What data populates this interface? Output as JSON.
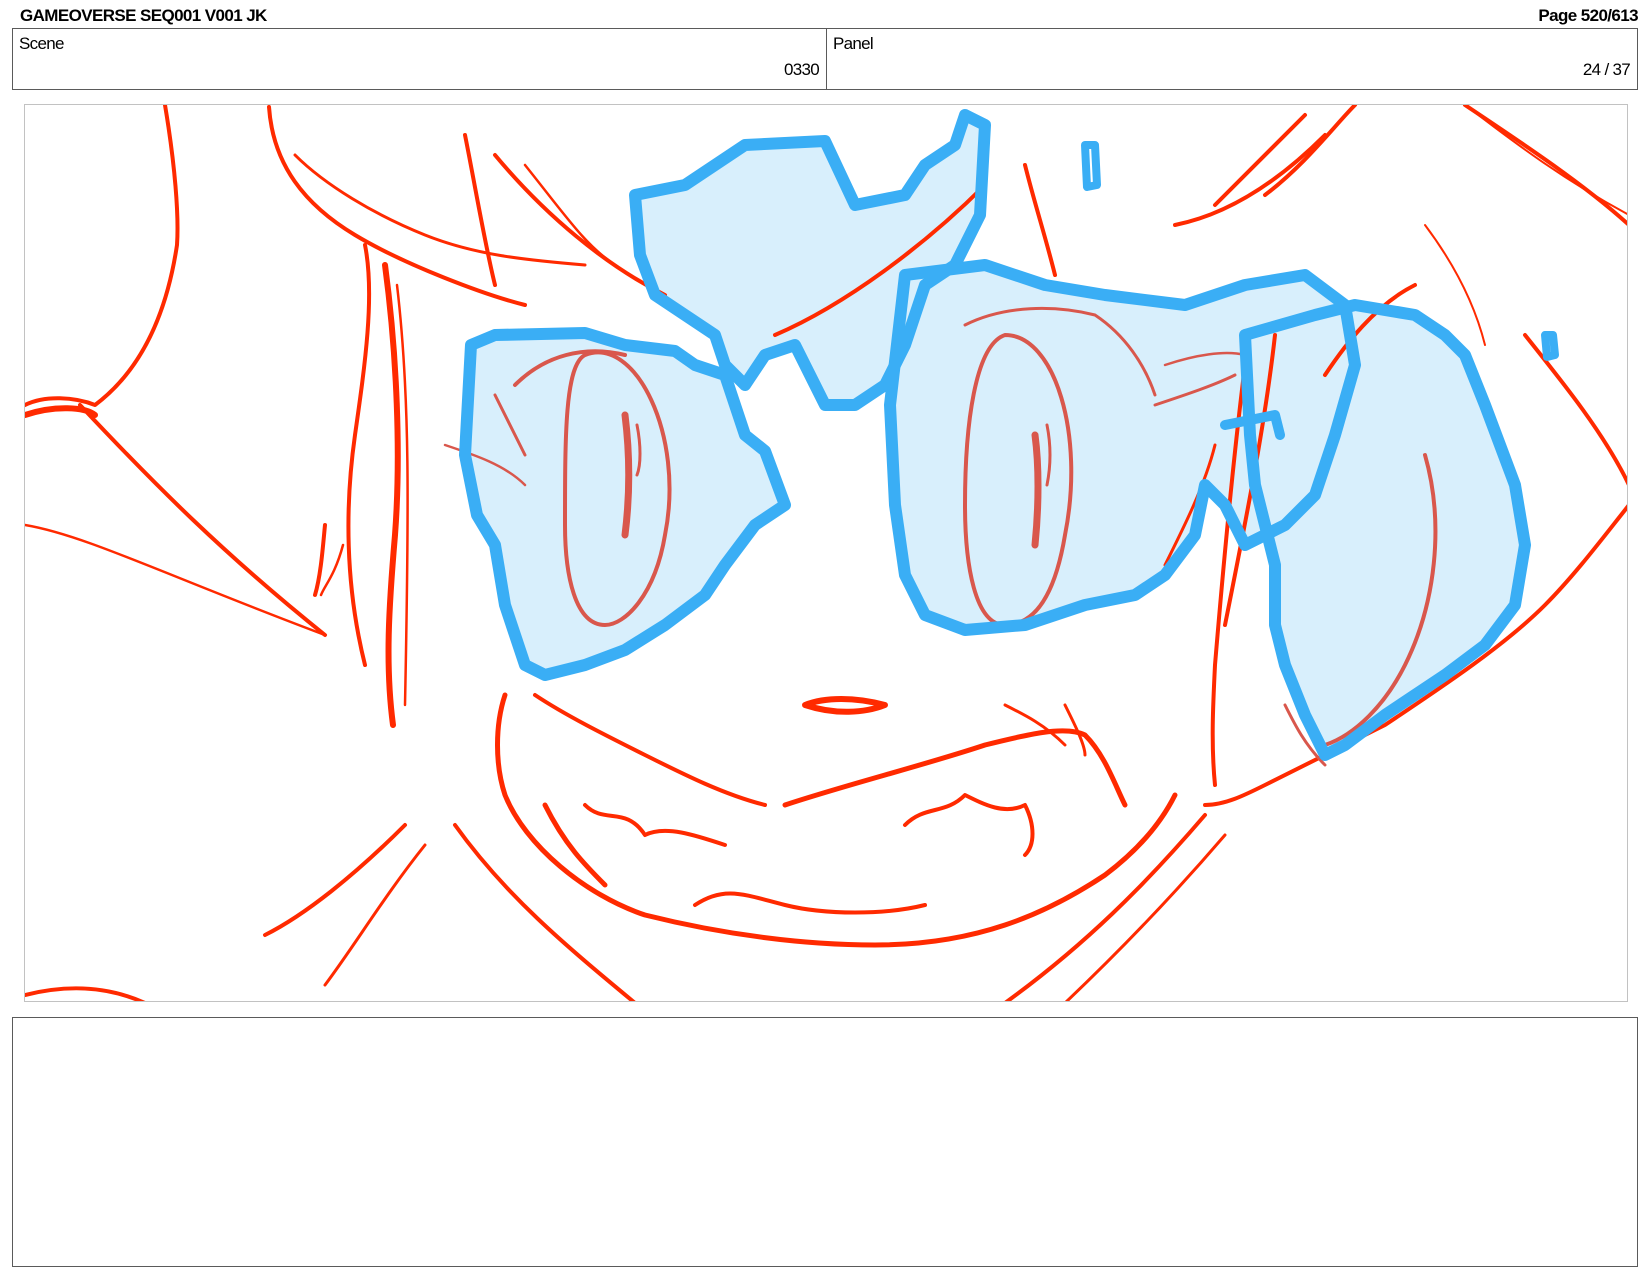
{
  "header": {
    "title": "GAMEOVERSE SEQ001 V001 JK",
    "page": "Page 520/613"
  },
  "scene": {
    "label": "Scene",
    "value": "0330"
  },
  "panel": {
    "label": "Panel",
    "value": "24 / 37"
  },
  "colors": {
    "sketch_red": "#ff2a00",
    "eye_red": "#d9574c",
    "glasses_blue": "#3aaef5",
    "glasses_fill": "#d8effc",
    "frame_border": "#c2c2c2",
    "box_border": "#5a5a5a"
  },
  "notes": {
    "text": ""
  }
}
